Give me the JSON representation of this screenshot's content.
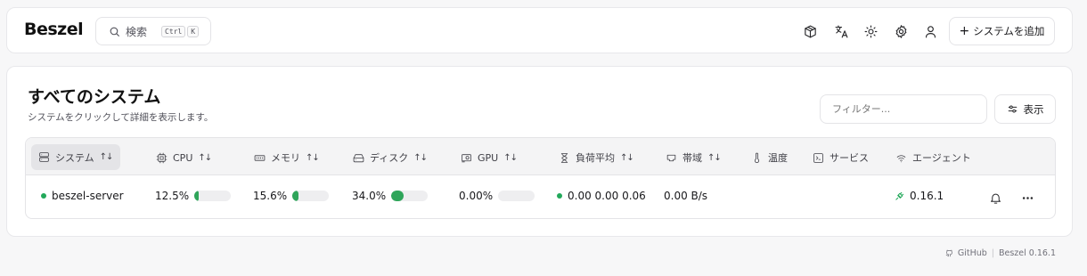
{
  "header": {
    "logo": "Beszel",
    "search_label": "検索",
    "search_kbd": [
      "Ctrl",
      "K"
    ],
    "icons": [
      "package-icon",
      "translate-icon",
      "theme-sun-icon",
      "settings-gear-icon",
      "user-icon"
    ],
    "add_system_label": "システムを追加"
  },
  "main": {
    "title": "すべてのシステム",
    "subtitle": "システムをクリックして詳細を表示します。",
    "filter_placeholder": "フィルター...",
    "view_label": "表示"
  },
  "table": {
    "columns": {
      "system": "システム",
      "cpu": "CPU",
      "memory": "メモリ",
      "disk": "ディスク",
      "gpu": "GPU",
      "load": "負荷平均",
      "bandwidth": "帯域",
      "temp": "温度",
      "services": "サービス",
      "agent": "エージェント"
    },
    "rows": [
      {
        "name": "beszel-server",
        "status_color": "#22a85a",
        "cpu_text": "12.5%",
        "cpu": 0.125,
        "memory_text": "15.6%",
        "memory": 0.156,
        "disk_text": "34.0%",
        "disk": 0.34,
        "gpu_text": "0.00%",
        "gpu": 0.0,
        "load_text": "0.00 0.00 0.06",
        "bandwidth_text": "0.00 B/s",
        "agent_version": "0.16.1"
      }
    ]
  },
  "footer": {
    "github_label": "GitHub",
    "version_label": "Beszel 0.16.1"
  },
  "colors": {
    "accent_green": "#2fa55a",
    "border": "#e4e4e7"
  }
}
